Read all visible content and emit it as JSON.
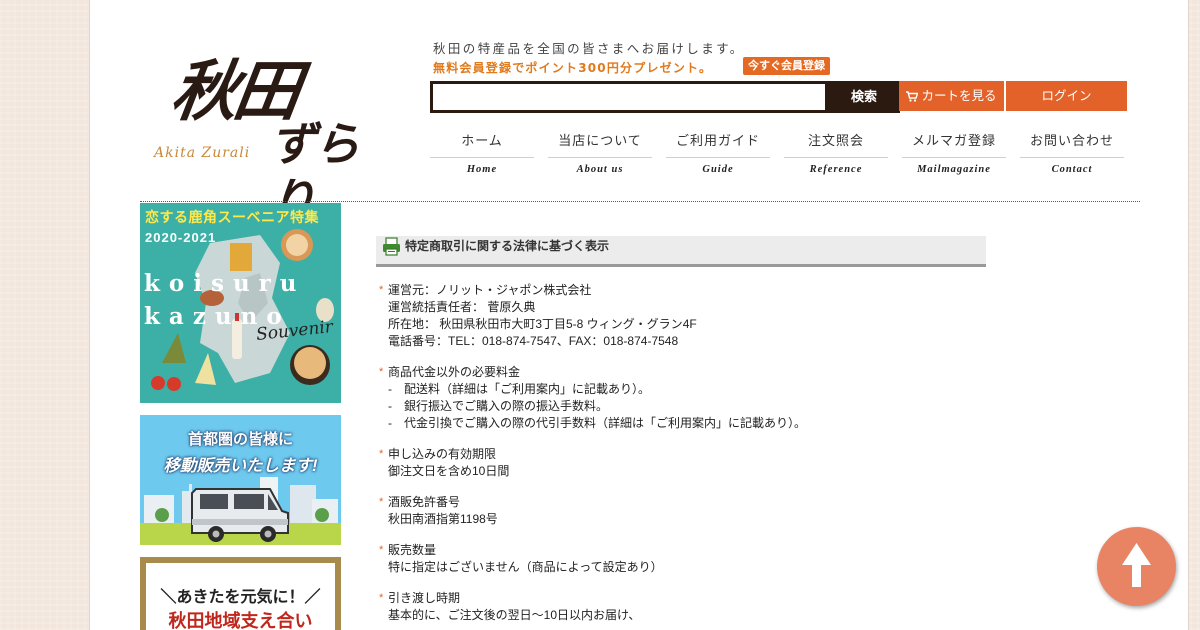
{
  "header": {
    "logo_kanji": "秋田",
    "logo_kana": "ずらり",
    "logo_roman": "Akita Zurali",
    "tagline": "秋田の特産品を全国の皆さまへお届けします。",
    "promo": "無料会員登録でポイント300円分プレゼント。",
    "promo_badge": "今すぐ会員登録",
    "search_value": "",
    "search_button": "検索",
    "cart_button": "カートを見る",
    "login_button": "ログイン"
  },
  "nav": [
    {
      "jp": "ホーム",
      "en": "Home"
    },
    {
      "jp": "当店について",
      "en": "About us"
    },
    {
      "jp": "ご利用ガイド",
      "en": "Guide"
    },
    {
      "jp": "注文照会",
      "en": "Reference"
    },
    {
      "jp": "メルマガ登録",
      "en": "Mailmagazine"
    },
    {
      "jp": "お問い合わせ",
      "en": "Contact"
    }
  ],
  "banners": {
    "souvenir": {
      "title": "恋する鹿角スーベニア特集",
      "year": "2020-2021",
      "roman1": "koisuru",
      "roman2": "kazuno",
      "script": "Souvenir"
    },
    "mobile_sales": {
      "line1": "首都圏の皆様に",
      "line2": "移動販売いたします!"
    },
    "support": {
      "line1": "＼あきたを元気に！／",
      "line2": "秋田地域支え合い"
    }
  },
  "section": {
    "title": "特定商取引に関する法律に基づく表示",
    "icon": "printer-icon"
  },
  "blocks": [
    {
      "head": "運営元：ノリット・ジャポン株式会社",
      "lines": [
        {
          "text": "運営統括責任者： 菅原久典",
          "dash": false
        },
        {
          "text": "所在地： 秋田県秋田市大町3丁目5-8 ウィング・グラン4F",
          "dash": false
        },
        {
          "text": "電話番号：TEL：018-874-7547、FAX：018-874-7548",
          "dash": false
        }
      ]
    },
    {
      "head": "商品代金以外の必要料金",
      "lines": [
        {
          "text": "配送料（詳細は「ご利用案内」に記載あり）。",
          "dash": true
        },
        {
          "text": "銀行振込でご購入の際の振込手数料。",
          "dash": true
        },
        {
          "text": "代金引換でご購入の際の代引手数料（詳細は「ご利用案内」に記載あり）。",
          "dash": true
        }
      ]
    },
    {
      "head": "申し込みの有効期限",
      "lines": [
        {
          "text": "御注文日を含め10日間",
          "dash": false
        }
      ]
    },
    {
      "head": "酒販免許番号",
      "lines": [
        {
          "text": "秋田南酒指第1198号",
          "dash": false
        }
      ]
    },
    {
      "head": "販売数量",
      "lines": [
        {
          "text": "特に指定はございません（商品によって設定あり）",
          "dash": false
        }
      ]
    },
    {
      "head": "引き渡し時期",
      "lines": [
        {
          "text": "基本的に、ご注文後の翌日～10日以内お届け、",
          "dash": false
        }
      ]
    }
  ],
  "colors": {
    "accent": "#e2622a",
    "dark": "#2b1a10",
    "promo": "#e07a1c",
    "totop": "#e88464"
  },
  "totop_icon": "arrow-up-icon"
}
